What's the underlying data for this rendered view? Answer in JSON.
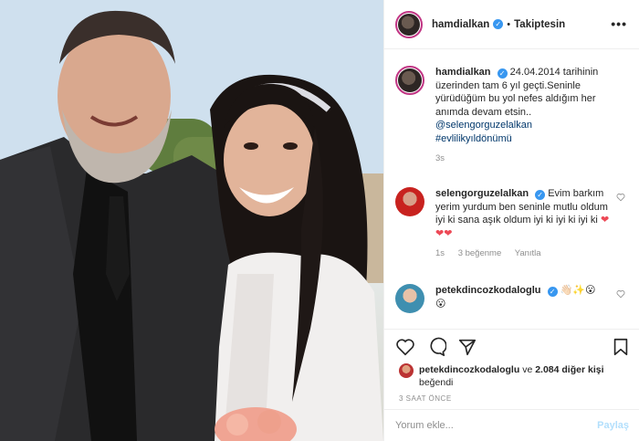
{
  "post": {
    "username": "hamdialkan",
    "follow_label": "Takiptesin",
    "more_label": "•••"
  },
  "caption": {
    "username": "hamdialkan",
    "text": "24.04.2014 tarihinin üzerinden tam 6 yıl geçti.Seninle yürüdüğüm bu yol nefes aldığım her anımda devam etsin..",
    "mention": "@selengorguzelalkan",
    "hashtag": "#evlilikyıldönümü",
    "time": "3s"
  },
  "comments": [
    {
      "username": "selengorguzelalkan",
      "text": "Evim barkım yerim yurdum ben seninle mutlu oldum iyi ki sana aşık oldum iyi ki iyi ki iyi ki",
      "emoji": "❤❤❤",
      "time": "1s",
      "likes": "3 beğenme",
      "reply": "Yanıtla"
    },
    {
      "username": "petekdincozkodaloglu",
      "text": "👋🏻✨😮",
      "emoji_line2": "😮"
    }
  ],
  "liked_by": {
    "username": "petekdincozkodaloglu",
    "connector": "ve",
    "others": "2.084 diğer kişi",
    "suffix": "beğendi"
  },
  "timestamp": "3 SAAT ÖNCE",
  "comment_input": {
    "placeholder": "Yorum ekle...",
    "post_label": "Paylaş"
  },
  "colors": {
    "verified": "#3897f0",
    "link": "#00376b",
    "muted": "#8e8e8e",
    "heart": "#ed4956"
  }
}
